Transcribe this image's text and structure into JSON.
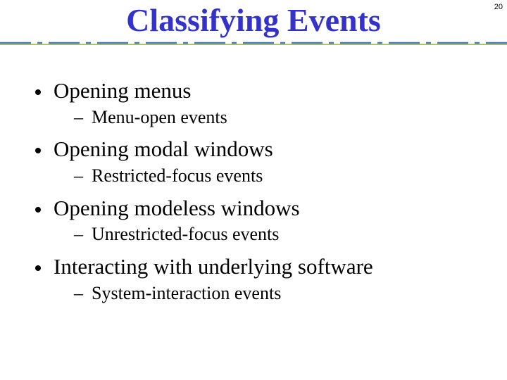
{
  "page_number": "20",
  "title": "Classifying Events",
  "bullets": [
    {
      "text": "Opening menus",
      "sub": "Menu-open events"
    },
    {
      "text": "Opening modal windows",
      "sub": "Restricted-focus events"
    },
    {
      "text": "Opening modeless windows",
      "sub": "Unrestricted-focus events"
    },
    {
      "text": "Interacting with underlying software",
      "sub": "System-interaction events"
    }
  ]
}
